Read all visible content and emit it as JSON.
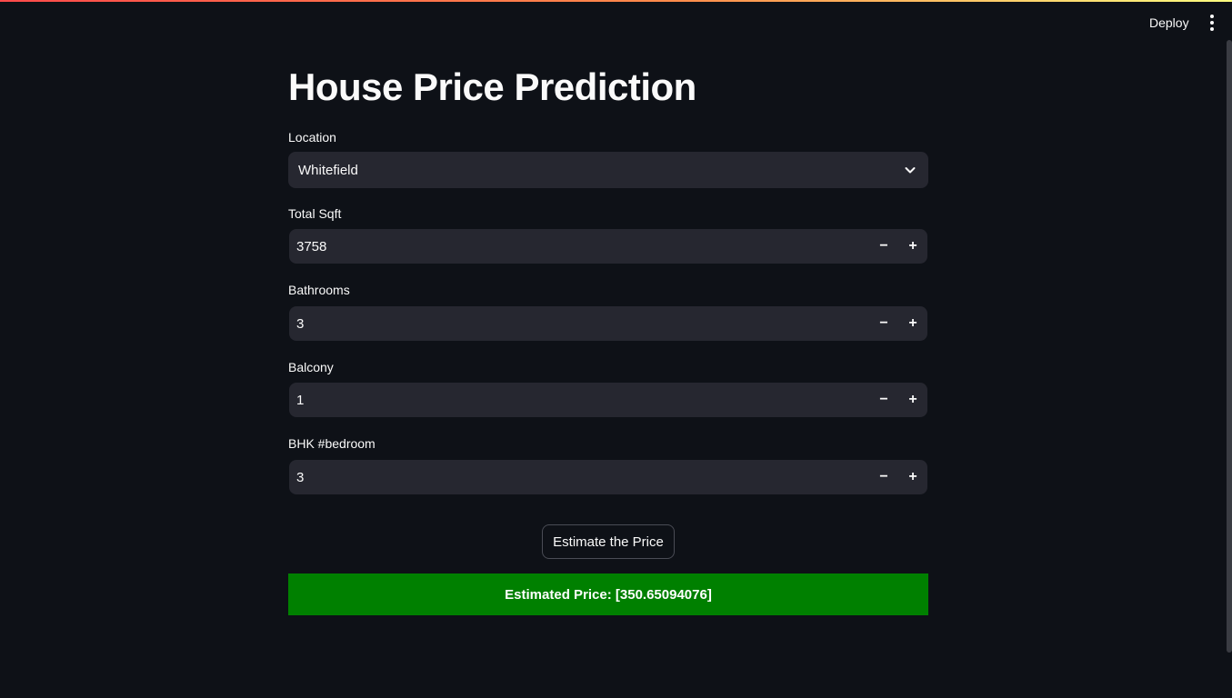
{
  "header": {
    "deploy_label": "Deploy",
    "menu_icon": "vertical-dots-icon"
  },
  "main": {
    "title": "House Price Prediction",
    "location": {
      "label": "Location",
      "selected": "Whitefield",
      "icon": "chevron-down-icon"
    },
    "total_sqft": {
      "label": "Total Sqft",
      "value": "3758"
    },
    "bathrooms": {
      "label": "Bathrooms",
      "value": "3"
    },
    "balcony": {
      "label": "Balcony",
      "value": "1"
    },
    "bhk": {
      "label": "BHK #bedroom",
      "value": "3"
    },
    "stepper": {
      "minus": "−",
      "plus": "+"
    },
    "estimate_button": "Estimate the Price",
    "result": "Estimated Price: [350.65094076]"
  },
  "colors": {
    "background": "#0e1117",
    "input_bg": "#262730",
    "result_bg": "#008000",
    "accent_stripe": "#ff4b4b"
  }
}
